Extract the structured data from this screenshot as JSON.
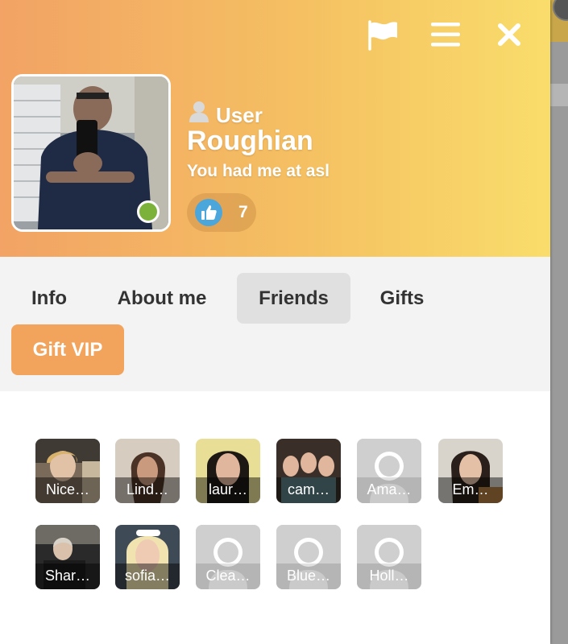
{
  "profile": {
    "rank": "User",
    "username": "Roughian",
    "mood": "You had me at asl",
    "likes": "7",
    "online": true,
    "status_color": "#7db23a"
  },
  "header_icons": [
    "flag-icon",
    "menu-icon",
    "close-icon"
  ],
  "tabs": [
    {
      "label": "Info",
      "active": false
    },
    {
      "label": "About me",
      "active": false
    },
    {
      "label": "Friends",
      "active": true
    },
    {
      "label": "Gifts",
      "active": false
    }
  ],
  "gift_vip_label": "Gift VIP",
  "friends": [
    {
      "name": "Nice…",
      "photo": true
    },
    {
      "name": "Lind…",
      "photo": true
    },
    {
      "name": "laur…",
      "photo": true
    },
    {
      "name": "cam…",
      "photo": true
    },
    {
      "name": "Ama…",
      "photo": false
    },
    {
      "name": "Em…",
      "photo": true
    },
    {
      "name": "Shar…",
      "photo": true
    },
    {
      "name": "sofia…",
      "photo": true
    },
    {
      "name": "Clea…",
      "photo": false
    },
    {
      "name": "Blue…",
      "photo": false
    },
    {
      "name": "Holl…",
      "photo": false
    }
  ],
  "colors": {
    "header_gradient_start": "#f2a365",
    "header_gradient_end": "#f9dd6b",
    "vip_button": "#f2a45d",
    "like_icon": "#4ba6dc",
    "active_tab": "#e0e0e0"
  }
}
